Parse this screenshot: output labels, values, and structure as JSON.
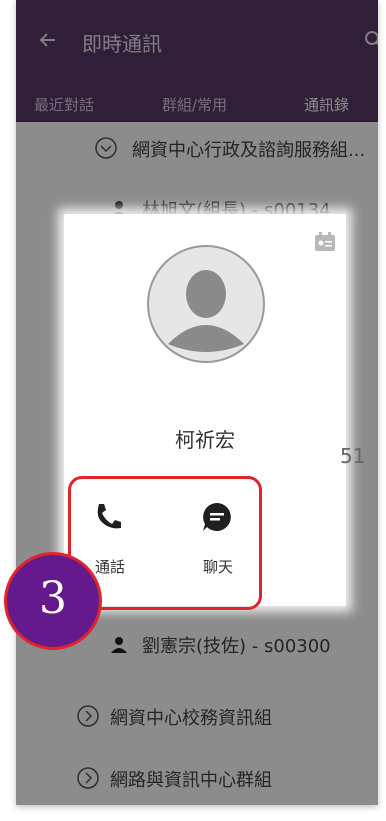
{
  "header": {
    "title": "即時通訊",
    "tabs": [
      {
        "label": "最近對話"
      },
      {
        "label": "群組/常用"
      },
      {
        "label": "通訊錄"
      }
    ]
  },
  "list": {
    "items": [
      {
        "type": "group",
        "label": "網資中心行政及諮詢服務組..."
      },
      {
        "type": "person",
        "label": "林旭文(組長) - s00134"
      },
      {
        "type": "person",
        "label": "劉憲宗(技佐) - s00300"
      },
      {
        "type": "group",
        "label": "網資中心校務資訊組"
      },
      {
        "type": "group",
        "label": "網路與資訊中心群組"
      }
    ]
  },
  "dialog": {
    "name": "柯祈宏",
    "side_text": "51",
    "actions": [
      {
        "label": "通話",
        "icon": "phone-icon"
      },
      {
        "label": "聊天",
        "icon": "chat-icon"
      }
    ]
  },
  "annotation": {
    "step_number": "3",
    "highlight_color": "#e0252a",
    "badge_color": "#641a8c"
  },
  "colors": {
    "header_bg": "#5a3a6a"
  }
}
